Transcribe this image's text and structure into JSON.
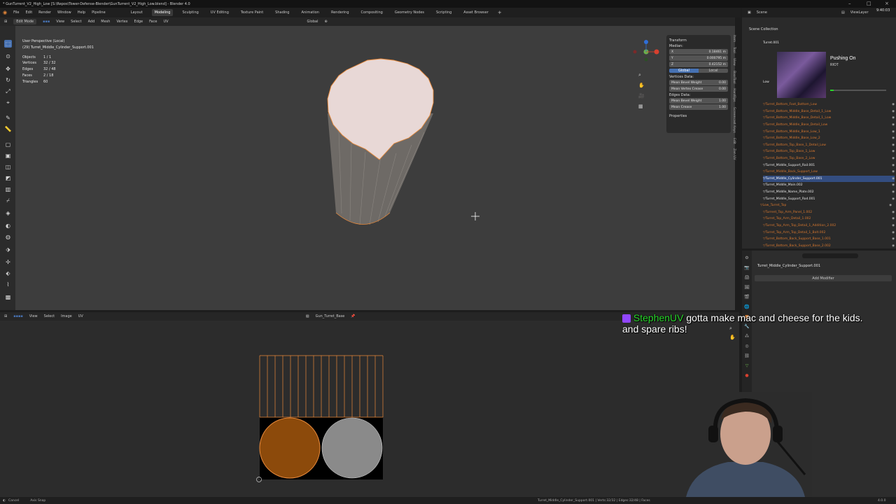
{
  "window": {
    "title": "* GunTurrent_V2_High_Low [S:\\Repos\\Tower-Defense-Blender\\GunTurrent_V2_High_Low.blend] - Blender 4.0"
  },
  "menu": {
    "items": [
      "File",
      "Edit",
      "Render",
      "Window",
      "Help",
      "Pipeline"
    ],
    "workspaces": [
      "Layout",
      "Modeling",
      "Sculpting",
      "UV Editing",
      "Texture Paint",
      "Shading",
      "Animation",
      "Rendering",
      "Compositing",
      "Geometry Nodes",
      "Scripting",
      "Asset Browser"
    ],
    "active_workspace": "Modeling"
  },
  "scene": {
    "name": "Scene",
    "view_layer": "ViewLayer"
  },
  "viewport_header": {
    "mode": "Edit Mode",
    "menus": [
      "View",
      "Select",
      "Add",
      "Mesh",
      "Vertex",
      "Edge",
      "Face",
      "UV"
    ],
    "orientation": "Global"
  },
  "viewport_overlay": {
    "view_name": "User Perspective (Local)",
    "object_name": "(29) Turret_Middle_Cylinder_Support.001",
    "stats": [
      {
        "label": "Objects",
        "value": "1 / 1"
      },
      {
        "label": "Vertices",
        "value": "32 / 32"
      },
      {
        "label": "Edges",
        "value": "32 / 48"
      },
      {
        "label": "Faces",
        "value": "2 / 18"
      },
      {
        "label": "Triangles",
        "value": "60"
      }
    ]
  },
  "transform_panel": {
    "title": "Transform",
    "median": "Median:",
    "x_label": "X",
    "x_value": "0.18461 m",
    "y_label": "Y",
    "y_value": "0.000795 m",
    "z_label": "Z",
    "z_value": "0.42152 m",
    "global_label": "Global",
    "local_label": "Local",
    "vertex_data": "Vertices Data:",
    "mean_bevel_weight_label": "Mean Bevel Weight",
    "mean_bevel_weight": "0.00",
    "mean_vertex_crease_label": "Mean Vertex Crease",
    "mean_vertex_crease": "0.00",
    "edge_data": "Edges Data:",
    "edge_bevel_weight_label": "Mean Bevel Weight",
    "edge_bevel_weight": "1.00",
    "mean_crease_label": "Mean Crease",
    "mean_crease": "1.00",
    "properties": "Properties"
  },
  "sidebar_tabs": [
    "Item",
    "Tool",
    "View",
    "BoolTool",
    "HardOps",
    "Screencast Keys",
    "Edit",
    "Zen UV"
  ],
  "outliner": {
    "header": "Scene Collection",
    "top_items": [
      "Turret.001",
      "Low"
    ],
    "rows": [
      "Turret_Bottom_Foot_Bottom_Low",
      "Turret_Bottom_Middle_Base_Detail_1_Low",
      "Turret_Bottom_Middle_Base_Detail_1_Low",
      "Turret_Bottom_Middle_Base_Detail_Low",
      "Turret_Bottom_Middle_Base_Low_1",
      "Turret_Bottom_Middle_Base_Low_2",
      "Turret_Bottom_Top_Base_1_Detail_Low",
      "Turret_Bottom_Top_Base_1_Low",
      "Turret_Bottom_Top_Base_2_Low",
      "Turret_Middle_Support_Rail.001",
      "Turret_Middle_Back_Support_Low",
      "Turret_Middle_Cylinder_Support.001",
      "Turret_Middle_Main.002",
      "Turret_Middle_Name_Plate.002",
      "Turret_Middle_Support_Rod.001",
      "Low_Turret_Top",
      "Turrent_Top_Arm_Panel_1.002",
      "Turret_Top_Arm_Detail_1.002",
      "Turret_Top_Arm_Top_Detail_1_Addition_2.002",
      "Turret_Top_Arm_Top_Detail_1_Bolt.002",
      "Turret_Bottom_Back_Support_Base_1.001",
      "Turret_Bottom_Back_Support_Base_2.002"
    ],
    "selected_index": 11
  },
  "properties": {
    "object_name": "Turret_Middle_Cylinder_Support.001",
    "add_modifier": "Add Modifier"
  },
  "uv_header": {
    "menus": [
      "View",
      "Select",
      "Image",
      "UV"
    ],
    "image_name": "Gun_Turret_Base"
  },
  "music": {
    "title": "Pushing On",
    "artist": "RIOT"
  },
  "chat": {
    "user": "StephenUV",
    "message": "gotta make mac and cheese for the kids. and spare ribs!"
  },
  "status": {
    "left": "Cancel",
    "left2": "Axis Snap",
    "right": "Turret_Middle_Cylinder_Support.001 | Verts:32/32 | Edges:32/48 | Faces",
    "version": "4.0.0"
  },
  "clock": "9:40:03",
  "colors": {
    "accent": "#4772b3",
    "edit_orange": "#e8893a",
    "uv_fill": "#8c4a0b",
    "outliner_orange": "#d7772e",
    "chat_user": "#28d62a"
  }
}
